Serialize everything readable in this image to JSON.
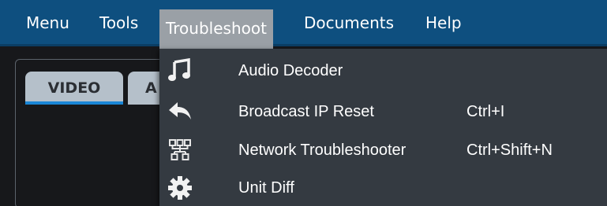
{
  "menubar": {
    "items": [
      {
        "label": "Menu"
      },
      {
        "label": "Tools"
      },
      {
        "label": "Troubleshoot"
      },
      {
        "label": "Documents"
      },
      {
        "label": "Help"
      }
    ]
  },
  "tabs": {
    "video": "VIDEO",
    "audio": "A"
  },
  "troubleshoot_menu": {
    "items": [
      {
        "label": "Audio Decoder",
        "shortcut": "",
        "icon": "music-note-icon"
      },
      {
        "label": "Broadcast IP Reset",
        "shortcut": "Ctrl+I",
        "icon": "reply-arrow-icon"
      },
      {
        "label": "Network Troubleshooter",
        "shortcut": "Ctrl+Shift+N",
        "icon": "network-icon"
      },
      {
        "label": "Unit Diff",
        "shortcut": "",
        "icon": "gear-icon"
      }
    ]
  },
  "colors": {
    "menubar": "#0e4f7f",
    "active_menu": "#9aa0a6",
    "dropdown": "#343a41",
    "tab": "#b5c0ca",
    "tab_underline": "#1a86d6"
  }
}
